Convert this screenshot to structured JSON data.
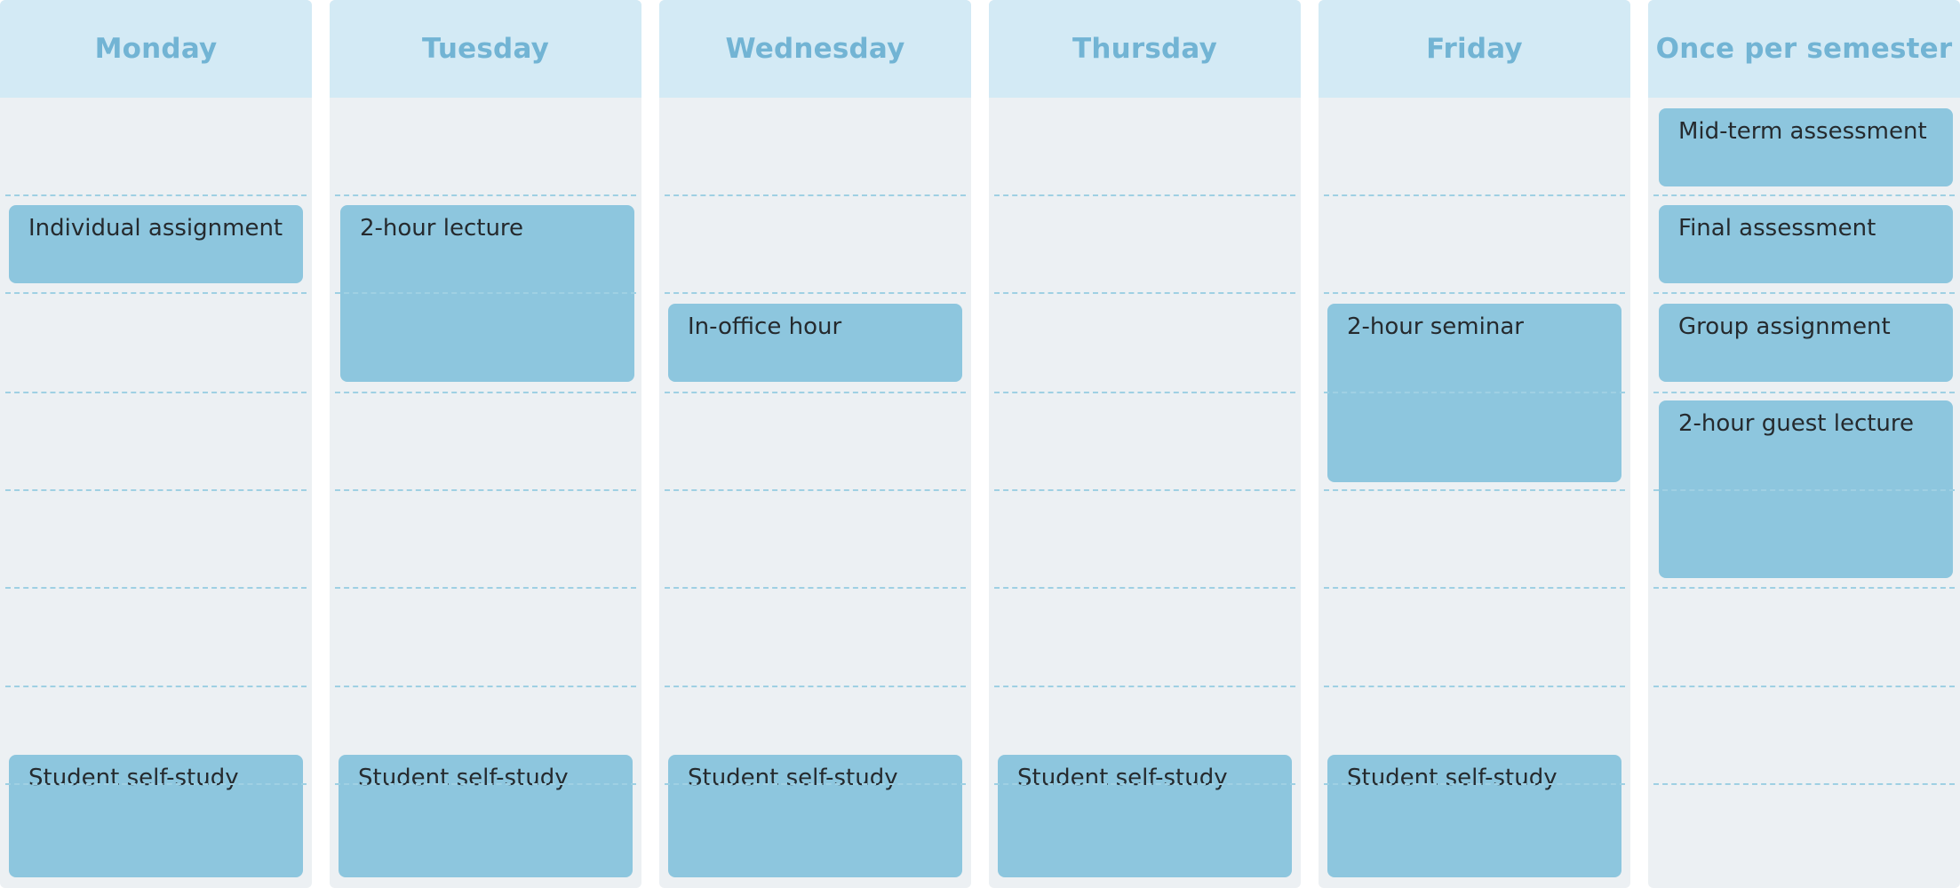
{
  "columns": [
    {
      "day": "Monday"
    },
    {
      "day": "Tuesday"
    },
    {
      "day": "Wednesday"
    },
    {
      "day": "Thursday"
    },
    {
      "day": "Friday"
    },
    {
      "day": "Once per semester"
    }
  ],
  "events": {
    "monday_assignment": "Individual assignment",
    "monday_study": "Student self-study",
    "tuesday_lecture": "2-hour lecture",
    "tuesday_study": "Student self-study",
    "wednesday_office": "In-office hour",
    "wednesday_study": "Student self-study",
    "thursday_study": "Student self-study",
    "friday_seminar": "2-hour seminar",
    "friday_study": "Student self-study",
    "semester_midterm": "Mid-term assessment",
    "semester_final": "Final assessment",
    "semester_group": "Group assignment",
    "semester_guest": "2-hour guest lecture"
  },
  "colors": {
    "column_bg": "#ecf0f3",
    "header_bg": "#d3eaf5",
    "header_text": "#72b4d4",
    "event_bg": "#8dc6de",
    "event_text": "#252a2e",
    "slot_line": "#9fd0e3"
  }
}
